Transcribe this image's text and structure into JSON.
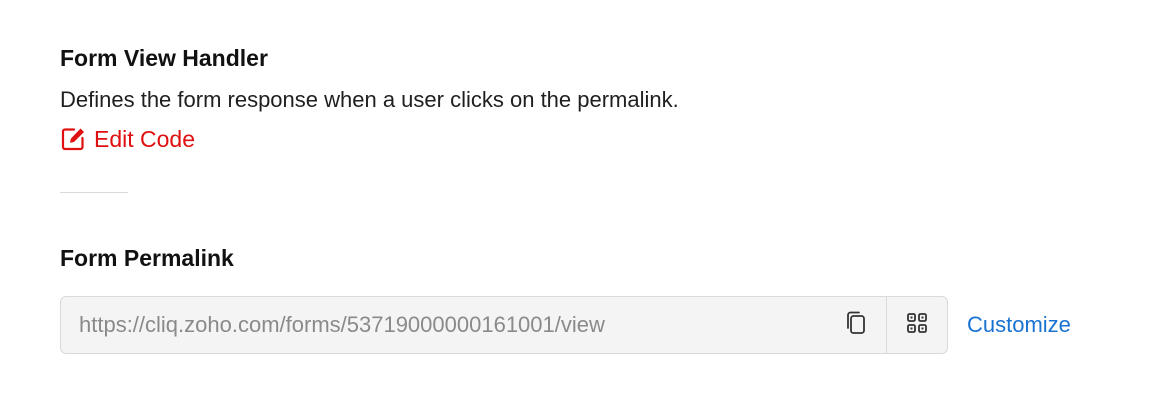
{
  "form_view_handler": {
    "title": "Form View Handler",
    "description": "Defines the form response when a user clicks on the permalink.",
    "edit_label": "Edit Code",
    "edit_icon": "edit-icon",
    "edit_color": "#e01010"
  },
  "form_permalink": {
    "title": "Form Permalink",
    "url": "https://cliq.zoho.com/forms/53719000000161001/view",
    "copy_icon": "copy-icon",
    "qr_icon": "qr-code-icon",
    "customize_label": "Customize",
    "link_color": "#1a73d1"
  }
}
